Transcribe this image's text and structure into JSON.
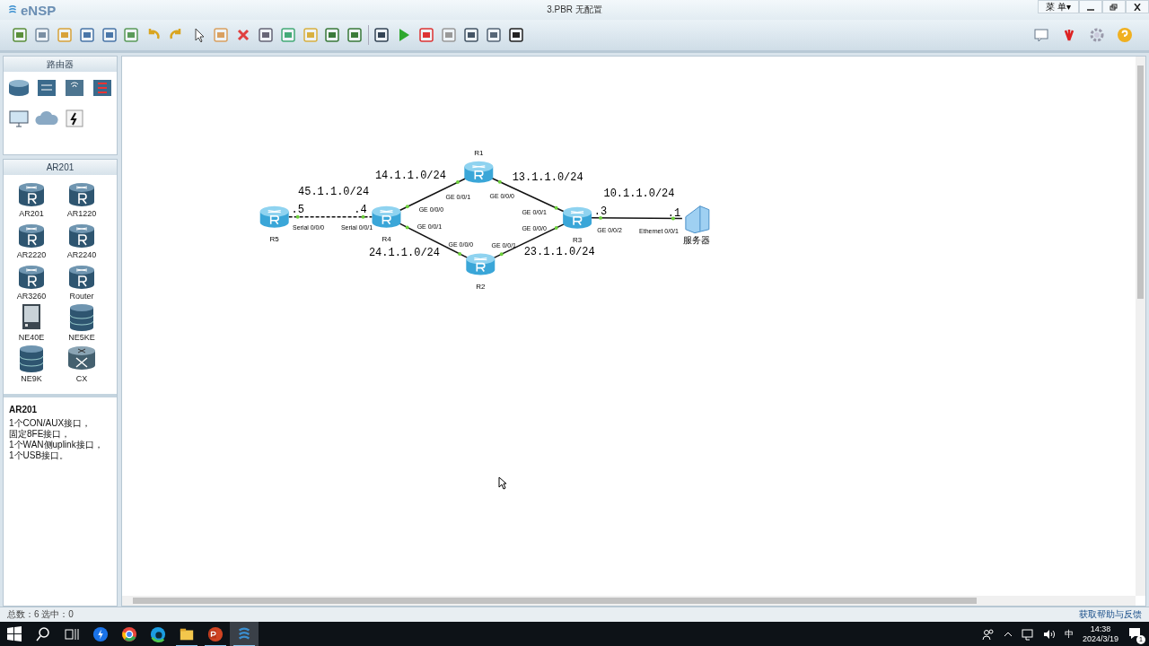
{
  "window": {
    "app_name": "eNSP",
    "title": "3.PBR 无配置",
    "menu_button": "菜 单▾"
  },
  "palette": {
    "category_title": "路由器",
    "categories": [
      {
        "kind": "router"
      },
      {
        "kind": "switch"
      },
      {
        "kind": "wireless"
      },
      {
        "kind": "firewall"
      },
      {
        "kind": "pc"
      },
      {
        "kind": "cloud"
      },
      {
        "kind": "power"
      }
    ],
    "device_title": "AR201",
    "devices": [
      {
        "name": "AR201",
        "kind": "router"
      },
      {
        "name": "AR1220",
        "kind": "router"
      },
      {
        "name": "AR2220",
        "kind": "router"
      },
      {
        "name": "AR2240",
        "kind": "router"
      },
      {
        "name": "AR3260",
        "kind": "router"
      },
      {
        "name": "Router",
        "kind": "router"
      },
      {
        "name": "NE40E",
        "kind": "chassis"
      },
      {
        "name": "NE5KE",
        "kind": "stack"
      },
      {
        "name": "NE9K",
        "kind": "stack"
      },
      {
        "name": "CX",
        "kind": "cx"
      }
    ],
    "description": {
      "title": "AR201",
      "lines": [
        "1个CON/AUX接口，",
        "固定8FE接口，",
        "1个WAN侧uplink接口，",
        "1个USB接口。"
      ]
    }
  },
  "topology": {
    "devices": [
      {
        "name": "R5",
        "kind": "router"
      },
      {
        "name": "R4",
        "kind": "router"
      },
      {
        "name": "R1",
        "kind": "router"
      },
      {
        "name": "R2",
        "kind": "router"
      },
      {
        "name": "R3",
        "kind": "router"
      },
      {
        "name": "服务器",
        "kind": "server"
      }
    ],
    "links": [
      {
        "kind": "serial",
        "a_port": "Serial 0/0/0",
        "b_port": "Serial 0/0/1"
      },
      {
        "kind": "ethernet",
        "a_port": "GE 0/0/0",
        "b_port": "GE 0/0/1"
      },
      {
        "kind": "ethernet",
        "a_port": "GE 0/0/1",
        "b_port": "GE 0/0/0"
      },
      {
        "kind": "ethernet",
        "a_port": "GE 0/0/0",
        "b_port": "GE 0/0/1"
      },
      {
        "kind": "ethernet",
        "a_port": "GE 0/0/1",
        "b_port": "GE 0/0/0"
      },
      {
        "kind": "ethernet",
        "a_port": "GE 0/0/2",
        "b_port": "Ethernet 0/0/1"
      }
    ],
    "subnet_labels": [
      "45.1.1.0/24",
      "14.1.1.0/24",
      "13.1.1.0/24",
      "10.1.1.0/24",
      "24.1.1.0/24",
      "23.1.1.0/24"
    ],
    "address_labels": [
      ".5",
      ".4",
      ".3",
      ".1"
    ]
  },
  "status_bar": {
    "counts": "总数：6 选中：0",
    "help_link": "获取帮助与反馈"
  },
  "taskbar": {
    "apps": [
      {
        "kind": "bolt",
        "open": false,
        "active": false
      },
      {
        "kind": "chrome",
        "open": false,
        "active": false
      },
      {
        "kind": "edge",
        "open": false,
        "active": false
      },
      {
        "kind": "folder",
        "open": true,
        "active": false
      },
      {
        "kind": "powerpoint",
        "open": true,
        "active": false
      },
      {
        "kind": "ensp",
        "open": true,
        "active": true
      }
    ],
    "ime": "中",
    "time": "14:38",
    "date": "2024/3/19",
    "notification_count": "1"
  }
}
